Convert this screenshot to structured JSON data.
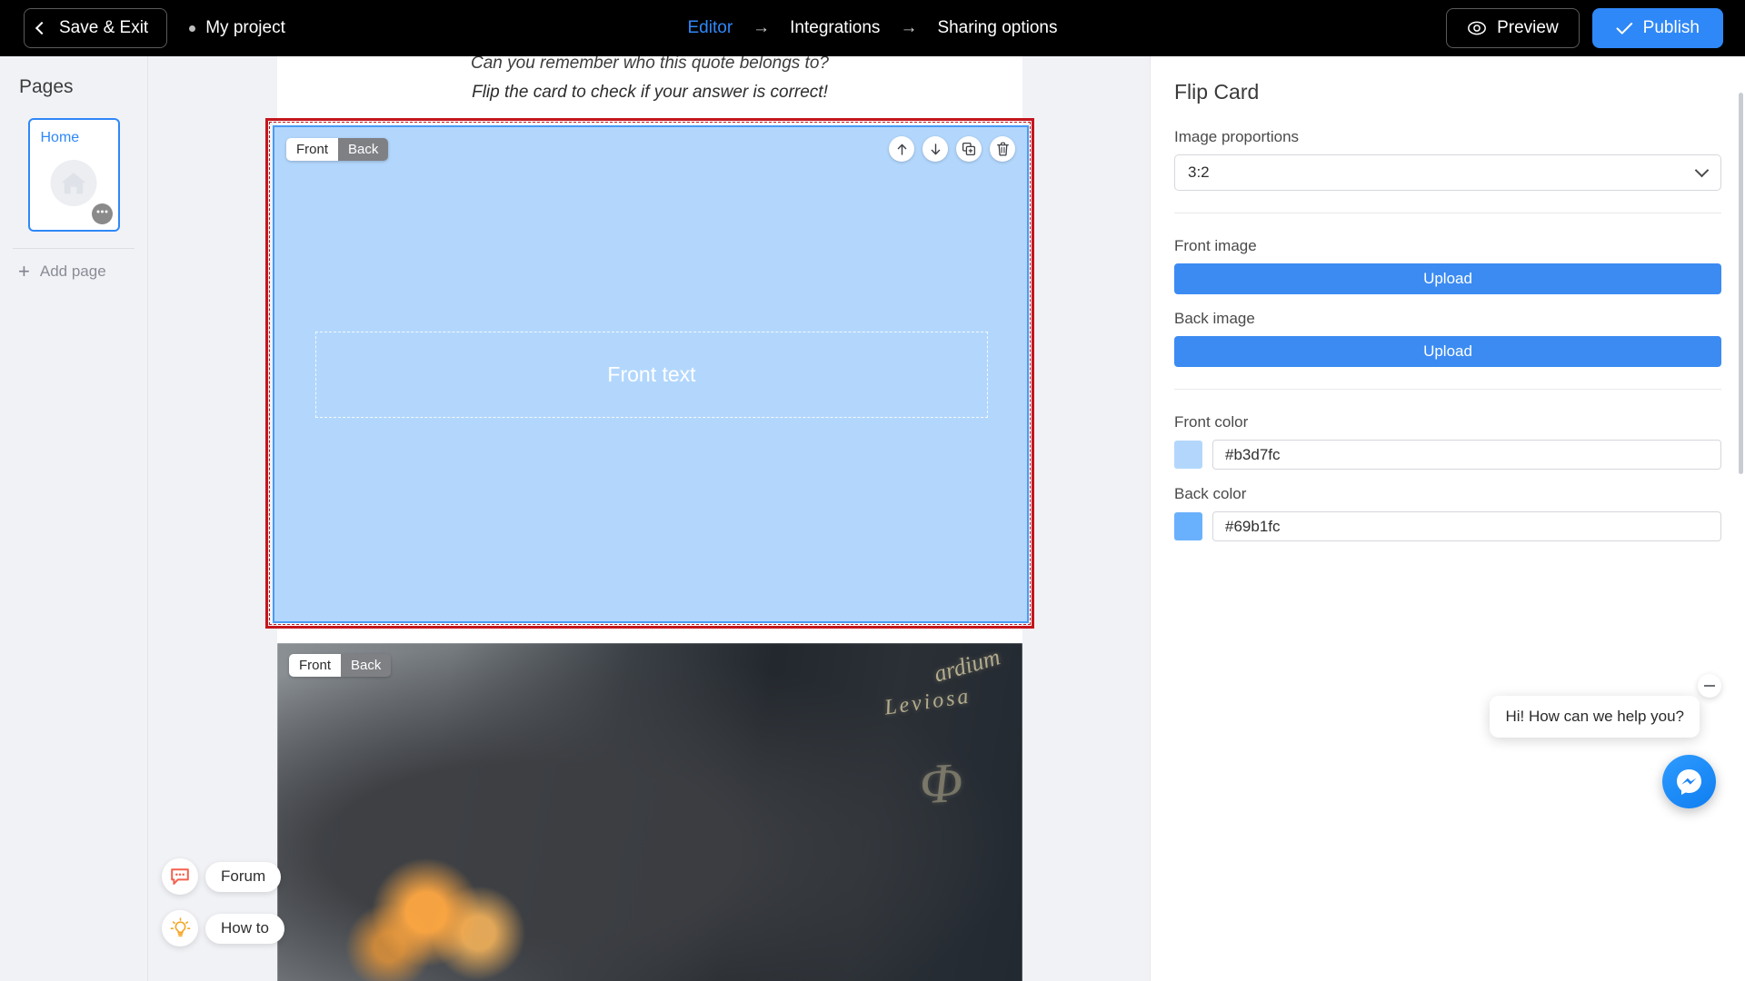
{
  "topbar": {
    "save_exit_label": "Save & Exit",
    "back_icon": "chevron-left-icon",
    "project_name": "My project",
    "steps": [
      {
        "label": "Editor",
        "active": true
      },
      {
        "label": "Integrations",
        "active": false
      },
      {
        "label": "Sharing options",
        "active": false
      }
    ],
    "arrow_glyph": "→",
    "preview_label": "Preview",
    "preview_icon": "eye-icon",
    "publish_label": "Publish",
    "publish_icon": "check-icon",
    "publish_color": "#2f88f7",
    "active_step_color": "#2f88f7",
    "background_color": "#000000"
  },
  "sidebar": {
    "title": "Pages",
    "pages": [
      {
        "label": "Home",
        "icon": "home-icon",
        "selected": true,
        "more_icon": "ellipsis-icon"
      }
    ],
    "add_page_label": "Add page",
    "add_page_icon": "plus-icon"
  },
  "canvas": {
    "quote_line1": "Can you remember who this quote belongs to?",
    "quote_line2": "Flip the card to check if your answer is correct!",
    "selected_block": {
      "type": "flip-card",
      "selection_color": "#c4161c",
      "front_label": "Front",
      "back_label": "Back",
      "active_side": "Front",
      "front_placeholder": "Front text",
      "front_color": "#b3d7fc",
      "tools": [
        {
          "name": "move-up-icon",
          "glyph": "↑"
        },
        {
          "name": "move-down-icon",
          "glyph": "↓"
        },
        {
          "name": "duplicate-icon",
          "glyph": ""
        },
        {
          "name": "delete-icon",
          "glyph": ""
        }
      ]
    },
    "second_block": {
      "type": "flip-card",
      "front_label": "Front",
      "back_label": "Back",
      "active_side": "Front",
      "chalk_text_1": "ardium",
      "chalk_text_2": "Leviosa",
      "chalk_text_3": "Φ"
    }
  },
  "right_panel": {
    "title": "Flip Card",
    "image_proportions_label": "Image proportions",
    "image_proportions_value": "3:2",
    "front_image_label": "Front image",
    "front_image_button": "Upload",
    "back_image_label": "Back image",
    "back_image_button": "Upload",
    "front_color_label": "Front color",
    "front_color_value": "#b3d7fc",
    "back_color_label": "Back color",
    "back_color_value": "#69b1fc",
    "upload_button_color": "#3b8bf2"
  },
  "help": {
    "forum_label": "Forum",
    "forum_icon": "speech-bubble-icon",
    "howto_label": "How to",
    "howto_icon": "lightbulb-icon"
  },
  "chat": {
    "message": "Hi! How can we help you?",
    "minimize_icon": "minimize-icon",
    "fab_icon": "messenger-icon"
  }
}
